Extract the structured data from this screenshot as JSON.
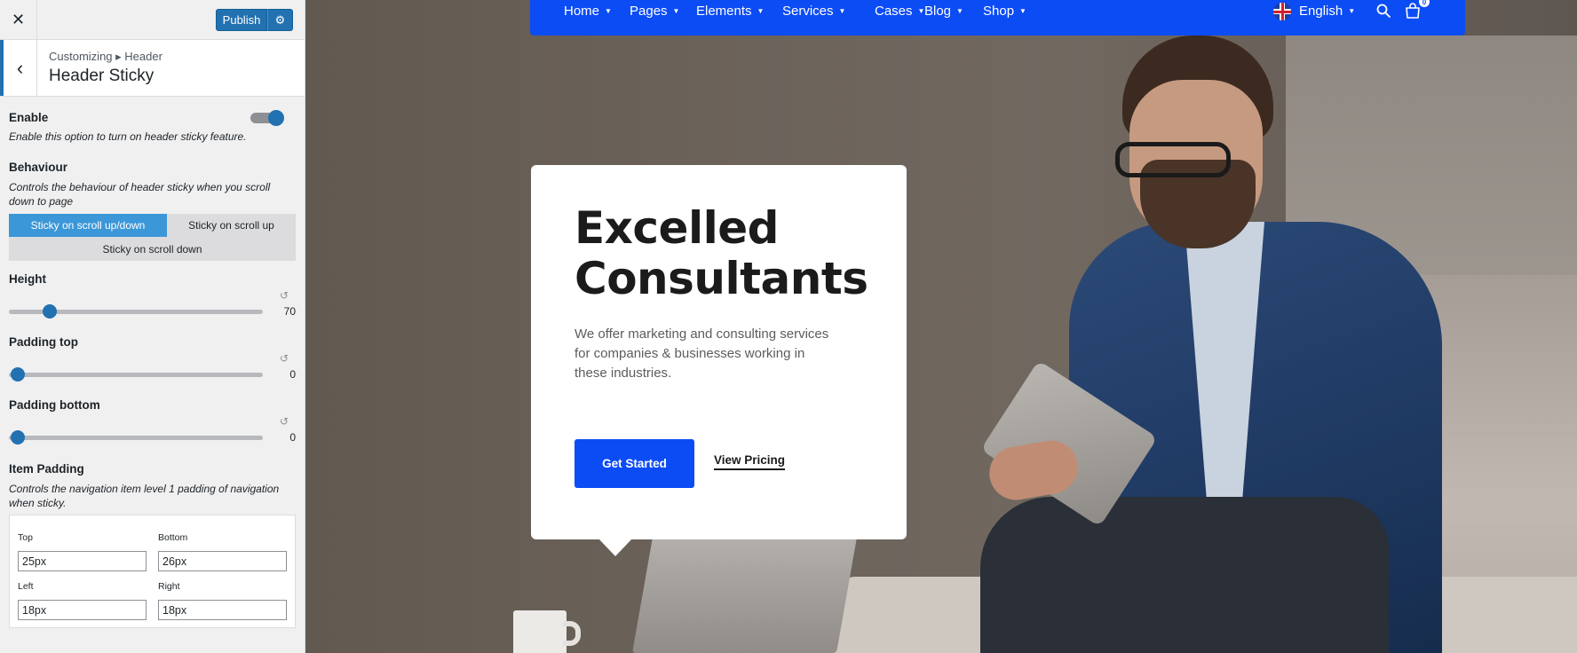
{
  "customizer": {
    "publish_label": "Publish",
    "breadcrumb": "Customizing ▸ Header",
    "section_title": "Header Sticky",
    "enable": {
      "label": "Enable",
      "description": "Enable this option to turn on header sticky feature.",
      "value": true
    },
    "behaviour": {
      "label": "Behaviour",
      "description": "Controls the behaviour of header sticky when you scroll down to page",
      "options": [
        "Sticky on scroll up/down",
        "Sticky on scroll up",
        "Sticky on scroll down"
      ],
      "selected": "Sticky on scroll up/down"
    },
    "height": {
      "label": "Height",
      "value": "70"
    },
    "padding_top": {
      "label": "Padding top",
      "value": "0"
    },
    "padding_bottom": {
      "label": "Padding bottom",
      "value": "0"
    },
    "item_padding": {
      "label": "Item Padding",
      "description": "Controls the navigation item level 1 padding of navigation when sticky.",
      "top_label": "Top",
      "top_value": "25px",
      "bottom_label": "Bottom",
      "bottom_value": "26px",
      "left_label": "Left",
      "left_value": "18px",
      "right_label": "Right",
      "right_value": "18px"
    }
  },
  "preview": {
    "nav": {
      "items": [
        "Home",
        "Pages",
        "Elements",
        "Services",
        "Cases",
        "Blog",
        "Shop"
      ],
      "language": "English",
      "cart_count": "0"
    },
    "hero": {
      "title_line1": "Excelled",
      "title_line2": "Consultants",
      "text": "We offer marketing and consulting services for companies & businesses working in these industries.",
      "cta_label": "Get Started",
      "link_label": "View Pricing"
    }
  },
  "colors": {
    "wp_blue": "#2271b1",
    "nav_blue": "#0c4cf5",
    "segment_active": "#3b97d8"
  }
}
